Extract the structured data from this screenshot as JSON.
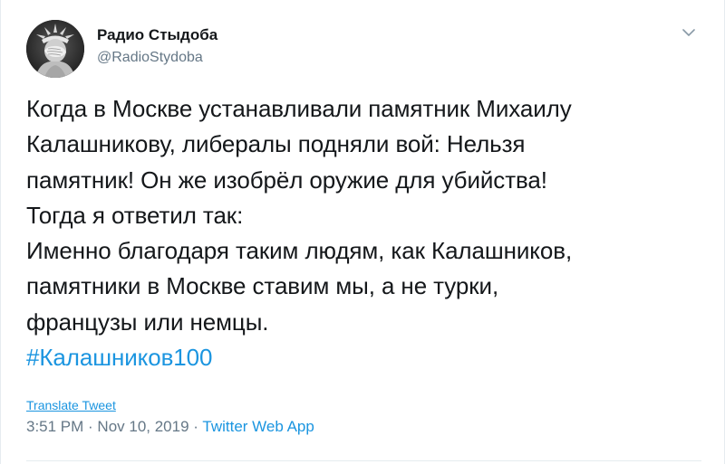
{
  "author": {
    "display_name": "Радио Стыдоба",
    "handle": "@RadioStydoba",
    "avatar_icon": "statue-of-liberty-facepalm-avatar"
  },
  "menu_icon": "chevron-down-icon",
  "tweet": {
    "lines": [
      "Когда в Москве устанавливали памятник Михаилу",
      "Калашникову, либералы подняли вой: Нельзя",
      "памятник! Он же изобрёл оружие для убийства!",
      "Тогда я ответил так:",
      "Именно благодаря таким людям, как Калашников,",
      "памятники в Москве ставим мы, а не турки,",
      "французы или немцы."
    ],
    "hashtag": "#Калашников100"
  },
  "translate_label": "Translate Tweet",
  "meta": {
    "time": "3:51 PM",
    "date": "Nov 10, 2019",
    "separator": " · ",
    "source_app": "Twitter Web App"
  },
  "colors": {
    "link": "#1b95e0",
    "secondary_text": "#657786",
    "primary_text": "#14171a",
    "border": "#e6ecf0"
  }
}
